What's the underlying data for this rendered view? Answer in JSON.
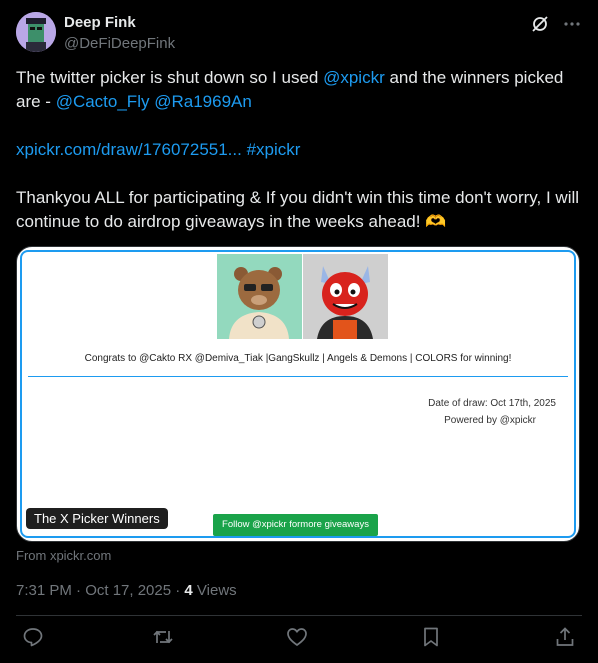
{
  "user": {
    "name": "Deep Fink",
    "handle": "@DeFiDeepFink"
  },
  "tweet": {
    "line1_pre": "The twitter picker is shut down so I used ",
    "mention_xpickr": "@xpickr",
    "line1_post": " and the winners picked are - ",
    "mention_1": "@Cacto_Fly",
    "mention_2": "@Ra1969An",
    "link": "xpickr.com/draw/176072551...",
    "hashtag": "#xpickr",
    "line3": "Thankyou ALL for participating & If you didn't win this time don't worry, I will continue to do airdrop giveaways in the weeks ahead! 🫶"
  },
  "card": {
    "congrats": "Congrats to @Cakto RX @Demiva_Tiak |GangSkullz | Angels & Demons | COLORS for winning!",
    "date_of_draw": "Date of draw: Oct 17th, 2025",
    "powered_by": "Powered by @xpickr",
    "badge": "The X Picker Winners",
    "follow_button": "Follow @xpickr formore giveaways"
  },
  "from": "From xpickr.com",
  "meta": {
    "time": "7:31 PM · Oct 17, 2025 · ",
    "views_count": "4",
    "views_label": " Views"
  },
  "icons": {
    "top": [
      "grok-icon",
      "more-icon"
    ],
    "actions": [
      "reply-icon",
      "repost-icon",
      "like-icon",
      "bookmark-icon",
      "share-icon"
    ]
  }
}
